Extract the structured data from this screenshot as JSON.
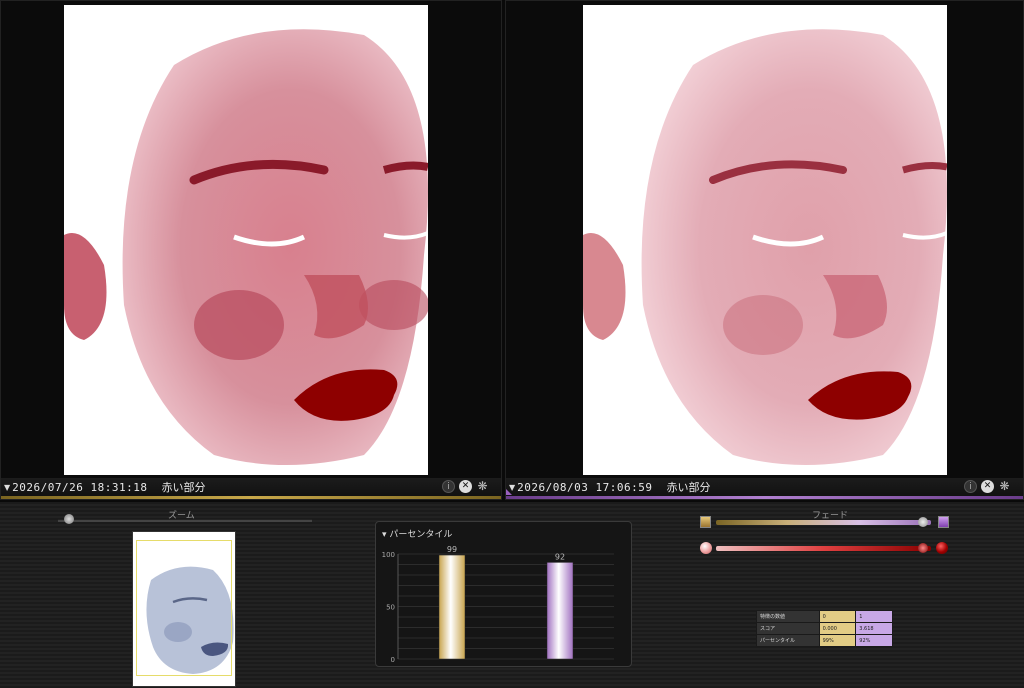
{
  "viewers": {
    "left": {
      "date": "2026/07/26 18:31:18",
      "label": "赤い部分"
    },
    "right": {
      "date": "2026/08/03 17:06:59",
      "label": "赤い部分"
    }
  },
  "zoom": {
    "title": "ズーム",
    "level": 0.05
  },
  "percentile_panel": {
    "title": "パーセンタイル"
  },
  "fade": {
    "title": "フェード",
    "level": 0.95
  },
  "stats_table": {
    "rows": [
      {
        "key": "特徴の数値",
        "a": "0",
        "b": "1"
      },
      {
        "key": "スコア",
        "a": "0.000",
        "b": "3.618"
      },
      {
        "key": "パーセンタイル",
        "a": "99%",
        "b": "92%"
      }
    ]
  },
  "chart_data": {
    "type": "bar",
    "categories": [
      "2026/07/26",
      "2026/08/03"
    ],
    "values": [
      99,
      92
    ],
    "ylim": [
      0,
      100
    ],
    "yticks": [
      0,
      50,
      100
    ],
    "colors": [
      "#c8a44e",
      "#a070c0"
    ],
    "title": "パーセンタイル"
  },
  "colors": {
    "left_accent": "#c8a84a",
    "right_accent": "#b080d0",
    "face_red": "#b02030"
  }
}
